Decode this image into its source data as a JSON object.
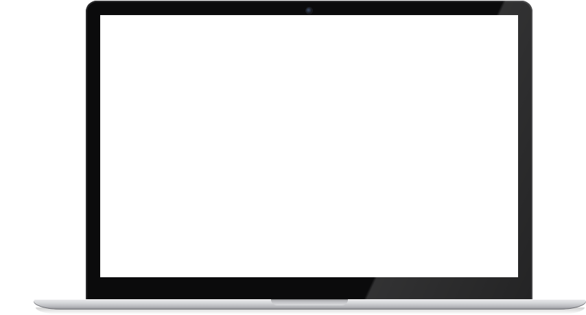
{
  "scene": {
    "subject": "laptop mockup",
    "screen_color": "#ffffff",
    "bezel_color": "#0b0b0c",
    "base_color": "#d6d7da"
  }
}
